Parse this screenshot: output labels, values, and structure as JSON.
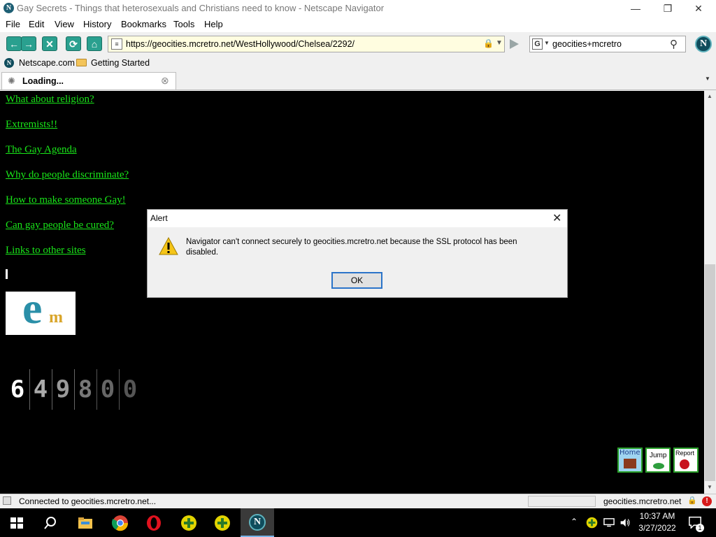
{
  "window": {
    "title": "Gay Secrets - Things that heterosexuals and Christians need to know - Netscape Navigator",
    "app_icon_letter": "N",
    "controls": {
      "minimize": "—",
      "maximize": "❐",
      "close": "✕"
    }
  },
  "menu": [
    {
      "label": "File"
    },
    {
      "label": "Edit"
    },
    {
      "label": "View"
    },
    {
      "label": "History"
    },
    {
      "label": "Bookmarks"
    },
    {
      "label": "Tools"
    },
    {
      "label": "Help"
    }
  ],
  "toolbar": {
    "url": "https://geocities.mcretro.net/WestHollywood/Chelsea/2292/",
    "search_engine": "G",
    "search_query": "geocities+mcretro",
    "logo_letter": "N"
  },
  "bookmarks": [
    {
      "label": "Netscape.com",
      "icon": "netscape-icon"
    },
    {
      "label": "Getting Started",
      "icon": "folder-icon"
    }
  ],
  "tab": {
    "label": "Loading...",
    "close_icon": "⊗"
  },
  "content": {
    "links": [
      "What about religion?",
      "Extremists!!",
      "The Gay Agenda",
      "Why do people discriminate?",
      "How to make someone Gay!",
      "Can gay people be cured?",
      "Links to other sites"
    ],
    "em_logo_letters": {
      "big": "e",
      "small": "m"
    },
    "counter_digits": [
      "6",
      "4",
      "9",
      "8",
      "0",
      "0"
    ],
    "badges": [
      {
        "label": "Home",
        "icon": "house-icon"
      },
      {
        "label": "Jump",
        "icon": "frog-icon"
      },
      {
        "label": "Report",
        "icon": "ladybug-icon"
      }
    ]
  },
  "dialog": {
    "title": "Alert",
    "message_line1": "Navigator can't connect securely to geocities.mcretro.net because the SSL protocol has been",
    "message_line2": "disabled.",
    "ok_label": "OK",
    "icon": "warning-icon"
  },
  "status": {
    "text": "Connected to geocities.mcretro.net...",
    "host": "geocities.mcretro.net"
  },
  "taskbar": {
    "time": "10:37 AM",
    "date": "3/27/2022",
    "notification_count": "1",
    "apps": [
      "windows-start-icon",
      "search-icon",
      "file-explorer-icon",
      "chrome-icon",
      "opera-icon",
      "plus-app-icon",
      "plus-app-icon",
      "netscape-icon"
    ]
  },
  "colors": {
    "link_green": "#19e619",
    "page_background": "#000000",
    "toolbar_teal": "#2aa08f",
    "url_background": "#fffde0"
  }
}
